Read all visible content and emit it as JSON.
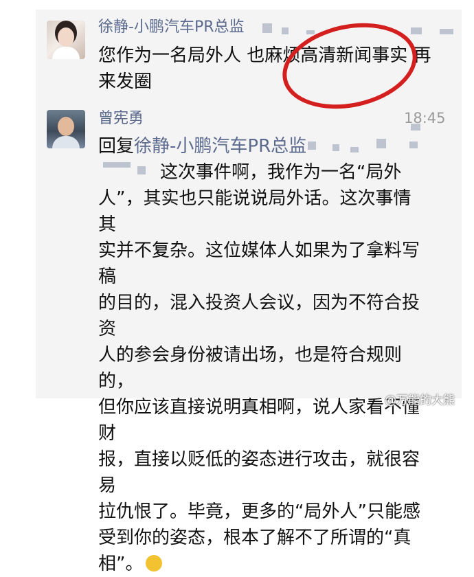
{
  "messages": [
    {
      "sender": "徐静-小鹏汽车PR总监",
      "text_line1": "您作为一名局外人 也麻烦高清新闻事实 再",
      "text_line2": "来发圈"
    },
    {
      "sender": "曾宪勇",
      "time": "18:45",
      "reply_prefix": "回复",
      "reply_to": "徐静-小鹏汽车PR总监",
      "lines": [
        "这次事件啊，我作为一名“局外",
        "人”，其实也只能说说局外话。这次事情其",
        "实并不复杂。这位媒体人如果为了拿料写稿",
        "的目的，混入投资人会议，因为不符合投资",
        "人的参会身份被请出场，也是符合规则的，",
        "但你应该直接说明真相啊，说人家看不懂财",
        "报，直接以贬低的姿态进行攻击，就很容易",
        "拉仇恨了。毕竟，更多的“局外人”只能感",
        "受到你的姿态，根本了解不了所谓的“真",
        "相”。"
      ],
      "emoji_icon": "laughing-tears-emoji-icon"
    }
  ],
  "watermark": "@万能的大熊",
  "colors": {
    "name_color": "#5b6a8d",
    "annotation_circle": "#d41f1f",
    "background": "#f4f4f4"
  }
}
